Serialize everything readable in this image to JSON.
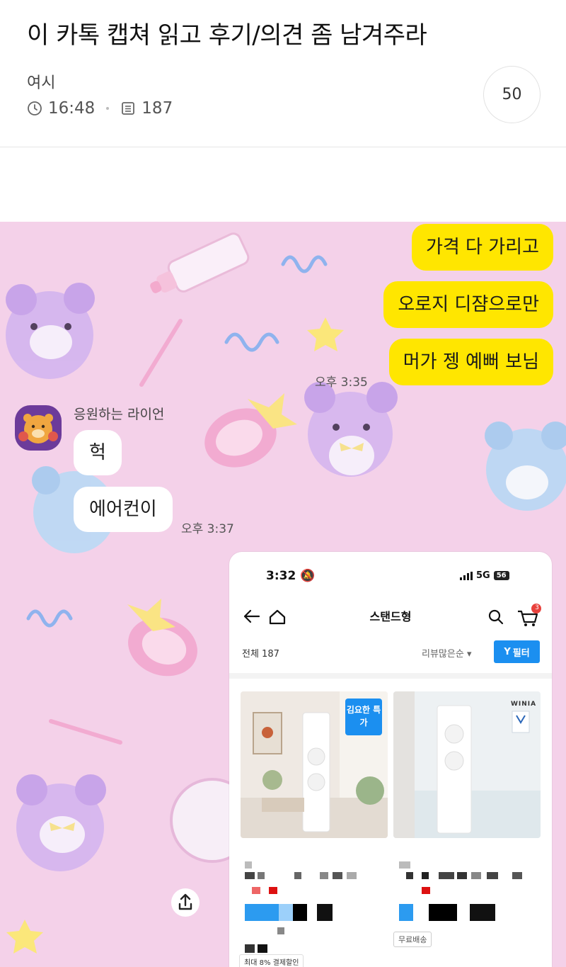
{
  "post": {
    "title": "이 카톡 캡쳐 읽고 후기/의견 좀 남겨주라",
    "author": "여시",
    "time": "16:48",
    "views": "187",
    "comment_count": "50"
  },
  "chat": {
    "my_messages": [
      "가격 다 가리고",
      "오로지 디쟘으로만",
      "머가 젱 예뻐 보님"
    ],
    "my_time": "오후 3:35",
    "sender_name": "응원하는 라이언",
    "their_messages": [
      "헉",
      "에어컨이"
    ],
    "their_time": "오후 3:37"
  },
  "phone": {
    "clock": "3:32",
    "network": "5G",
    "battery": "56",
    "title": "스탠드형",
    "cart_badge": "3",
    "total": "전체 187",
    "sort": "리뷰많은순",
    "filter": "필터",
    "badge_special": "김요한 특가",
    "brand": "WINIA",
    "free_shipping": "무료배송",
    "discount": "최대 8% 결제할인"
  },
  "colors": {
    "chat_bg": "#f4d1e9",
    "my_bubble": "#ffe600",
    "accent_blue": "#1b8ff0"
  }
}
